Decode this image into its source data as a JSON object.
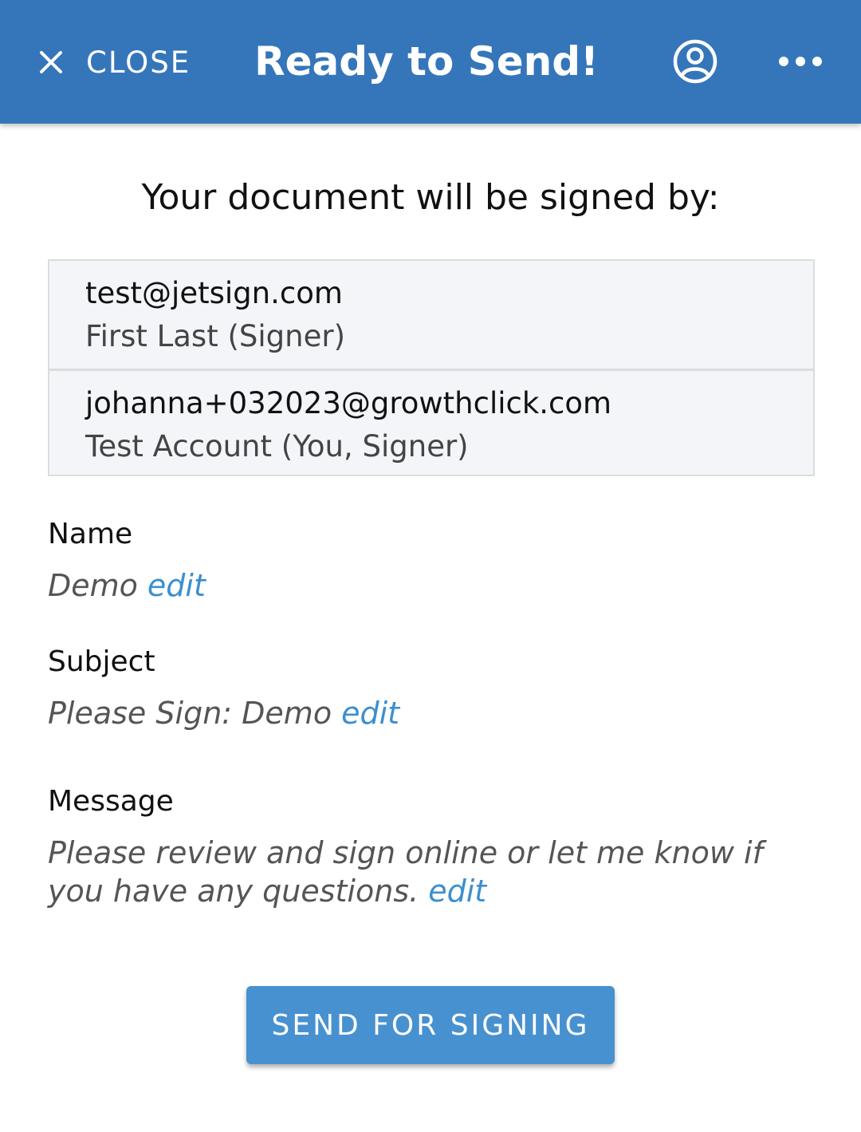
{
  "header": {
    "close_label": "CLOSE",
    "title": "Ready to Send!",
    "background_color": "#3576ba",
    "icons": [
      "close-icon",
      "account-icon",
      "more-icon"
    ]
  },
  "heading": "Your document will be signed by:",
  "signers": [
    {
      "email": "test@jetsign.com",
      "name": "First Last (Signer)"
    },
    {
      "email": "johanna+032023@growthclick.com",
      "name": "Test Account (You, Signer)"
    }
  ],
  "fields": {
    "name": {
      "label": "Name",
      "value": "Demo",
      "edit_label": "edit"
    },
    "subject": {
      "label": "Subject",
      "value": "Please Sign: Demo",
      "edit_label": "edit"
    },
    "message": {
      "label": "Message",
      "value": "Please review and sign online or let me know if you have any questions.",
      "edit_label": "edit"
    }
  },
  "send_button": {
    "label": "SEND FOR SIGNING",
    "color": "#4891d0"
  }
}
